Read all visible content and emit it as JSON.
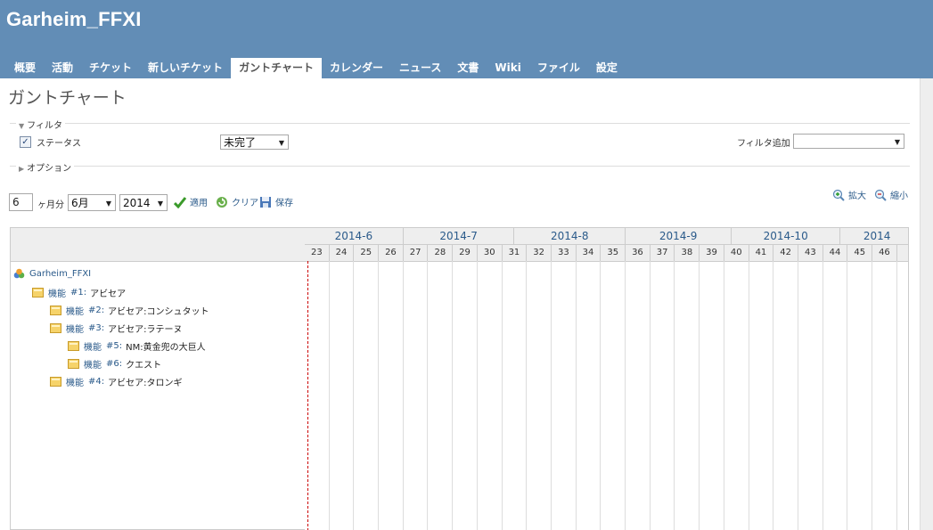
{
  "header": {
    "project_title": "Garheim_FFXI",
    "brand_color": "#628db6",
    "menu": [
      {
        "label": "概要",
        "selected": false
      },
      {
        "label": "活動",
        "selected": false
      },
      {
        "label": "チケット",
        "selected": false
      },
      {
        "label": "新しいチケット",
        "selected": false
      },
      {
        "label": "ガントチャート",
        "selected": true
      },
      {
        "label": "カレンダー",
        "selected": false
      },
      {
        "label": "ニュース",
        "selected": false
      },
      {
        "label": "文書",
        "selected": false
      },
      {
        "label": "Wiki",
        "selected": false
      },
      {
        "label": "ファイル",
        "selected": false
      },
      {
        "label": "設定",
        "selected": false
      }
    ]
  },
  "page_title": "ガントチャート",
  "filters": {
    "legend": "フィルタ",
    "status_label": "ステータス",
    "status_checked": true,
    "status_value": "未完了",
    "add_filter_label": "フィルタ追加",
    "add_filter_value": ""
  },
  "options": {
    "legend": "オプション"
  },
  "toolbar": {
    "months_value": "6",
    "months_label": "ヶ月分",
    "month_value": "6月",
    "year_value": "2014",
    "apply_label": "適用",
    "clear_label": "クリア",
    "save_label": "保存",
    "zoom_in_label": "拡大",
    "zoom_out_label": "縮小"
  },
  "gantt": {
    "project": "Garheim_FFXI",
    "issues": [
      {
        "level": 1,
        "tracker": "機能",
        "id": "#1:",
        "subject": "アビセア"
      },
      {
        "level": 2,
        "tracker": "機能",
        "id": "#2:",
        "subject": "アビセア:コンシュタット"
      },
      {
        "level": 2,
        "tracker": "機能",
        "id": "#3:",
        "subject": "アビセア:ラテーヌ"
      },
      {
        "level": 3,
        "tracker": "機能",
        "id": "#5:",
        "subject": "NM:黄金兜の大巨人"
      },
      {
        "level": 3,
        "tracker": "機能",
        "id": "#6:",
        "subject": "クエスト"
      },
      {
        "level": 2,
        "tracker": "機能",
        "id": "#4:",
        "subject": "アビセア:タロンギ"
      }
    ],
    "months": [
      {
        "label": "2014-6",
        "weeks": 4
      },
      {
        "label": "2014-7",
        "weeks": 4.5
      },
      {
        "label": "2014-8",
        "weeks": 4.5
      },
      {
        "label": "2014-9",
        "weeks": 4.3
      },
      {
        "label": "2014-10",
        "weeks": 4.4
      },
      {
        "label": "2014",
        "weeks": 3
      }
    ],
    "weeks": [
      "23",
      "24",
      "25",
      "26",
      "27",
      "28",
      "29",
      "30",
      "31",
      "32",
      "33",
      "34",
      "35",
      "36",
      "37",
      "38",
      "39",
      "40",
      "41",
      "42",
      "43",
      "44",
      "45",
      "46"
    ],
    "today_week_offset": 0.08
  }
}
